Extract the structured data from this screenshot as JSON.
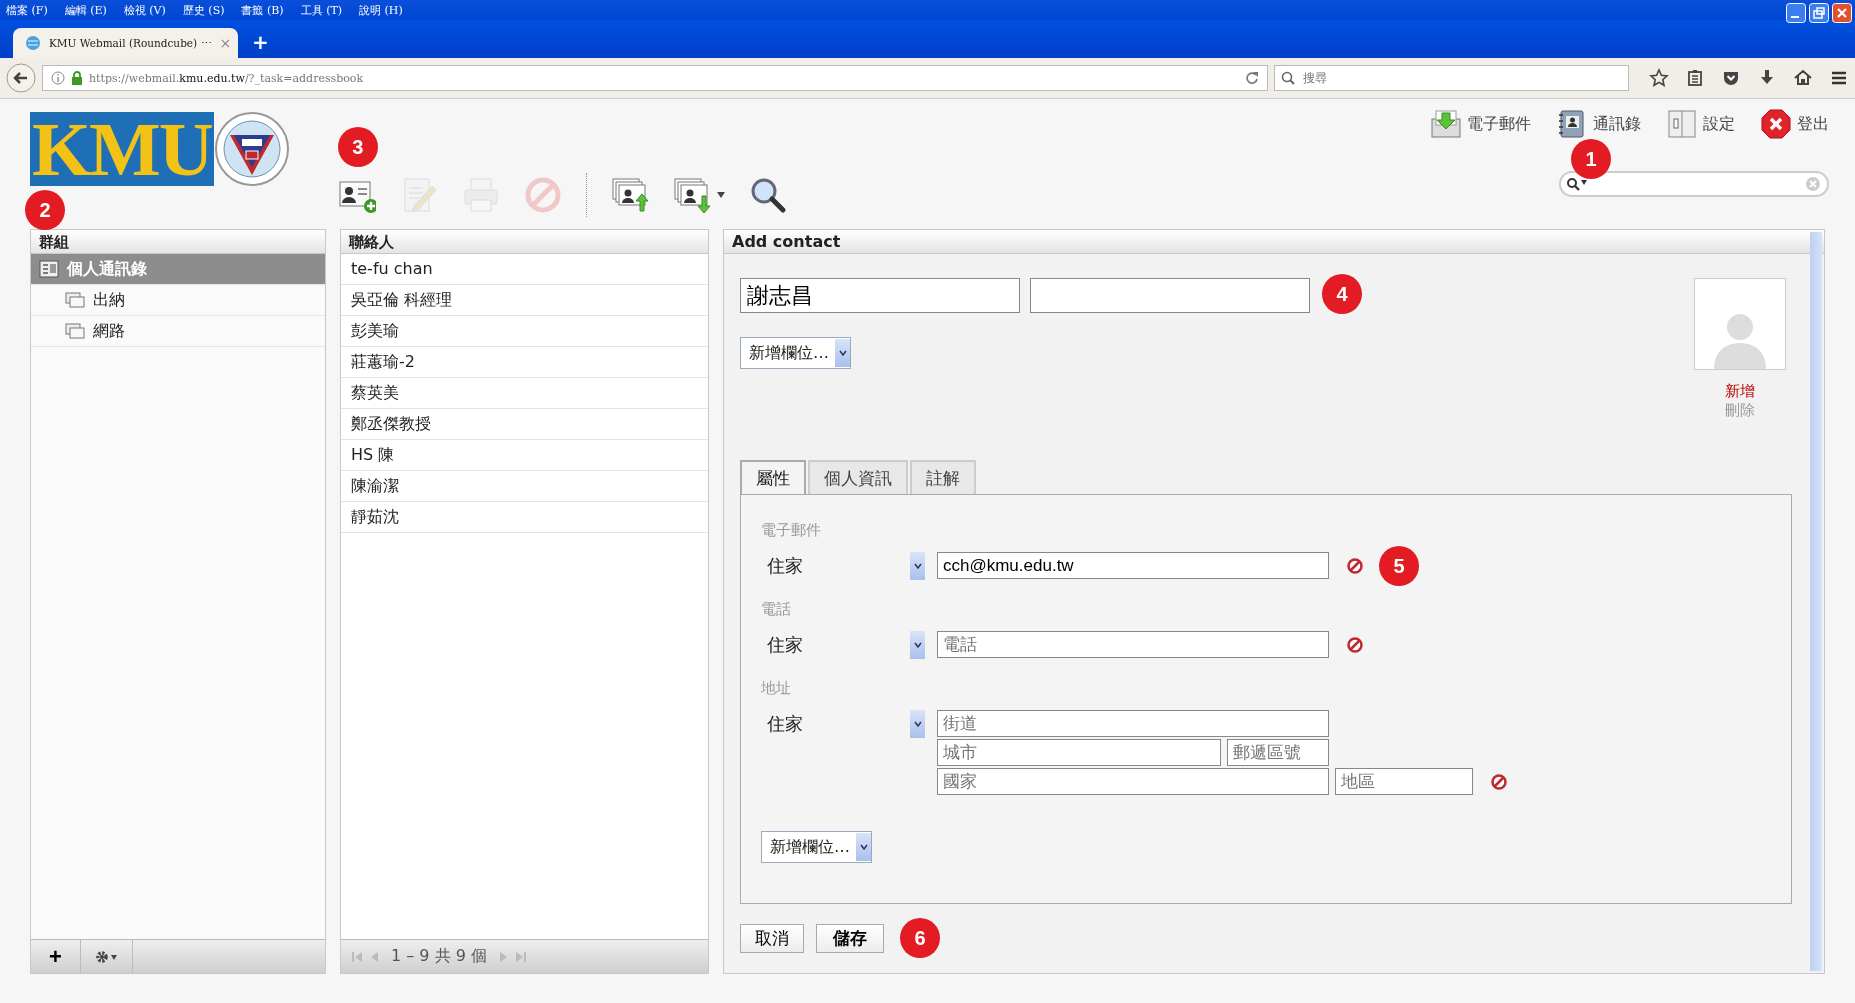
{
  "browser": {
    "menu": [
      "檔案 (F)",
      "編輯 (E)",
      "檢視 (V)",
      "歷史 (S)",
      "書籤 (B)",
      "工具 (T)",
      "說明 (H)"
    ],
    "tab": {
      "title": "KMU Webmail (Roundcube) ⋯",
      "close": "×"
    },
    "new_tab": "+",
    "url": {
      "host_prefix": "https://webmail.",
      "host": "kmu.edu.tw",
      "path": "/?_task=addressbook"
    },
    "search": {
      "placeholder": "搜尋"
    }
  },
  "app": {
    "logo": "KMU",
    "nav": [
      {
        "label": "電子郵件",
        "kind": "mail"
      },
      {
        "label": "通訊錄",
        "kind": "contacts"
      },
      {
        "label": "設定",
        "kind": "settings"
      },
      {
        "label": "登出",
        "kind": "logout"
      }
    ],
    "toolbar": [
      {
        "kind": "create",
        "disabled": false
      },
      {
        "kind": "edit",
        "disabled": true
      },
      {
        "kind": "print",
        "disabled": true
      },
      {
        "kind": "delete",
        "disabled": true
      },
      {
        "kind": "separator"
      },
      {
        "kind": "import",
        "disabled": false
      },
      {
        "kind": "export",
        "disabled": false
      },
      {
        "kind": "search",
        "disabled": false
      }
    ],
    "groups": {
      "title": "群組",
      "items": [
        {
          "label": "個人通訊錄",
          "selected": true,
          "children": [
            {
              "label": "出納",
              "selected": false
            },
            {
              "label": "網路",
              "selected": false
            }
          ]
        }
      ],
      "footer": [
        "+"
      ]
    },
    "contacts": {
      "title": "聯絡人",
      "items": [
        {
          "name": "te-fu chan",
          "selected": false
        },
        {
          "name": "吳亞倫 科經理",
          "selected": false
        },
        {
          "name": "彭美瑜",
          "selected": false
        },
        {
          "name": "莊蕙瑜-2",
          "selected": false
        },
        {
          "name": "蔡英美",
          "selected": false
        },
        {
          "name": "鄭丞傑教授",
          "selected": false
        },
        {
          "name": "HS 陳",
          "selected": false
        },
        {
          "name": "陳渝潔",
          "selected": false
        },
        {
          "name": "靜茹沈",
          "selected": false
        }
      ],
      "pager": "1 – 9 共 9 個"
    },
    "form": {
      "title": "Add contact",
      "name_value": "謝志昌",
      "add_field": "新增欄位…",
      "photo_actions": [
        {
          "label": "新增",
          "disabled": false
        },
        {
          "label": "刪除",
          "disabled": true
        }
      ],
      "tabs": [
        {
          "label": "屬性",
          "selected": true
        },
        {
          "label": "個人資訊",
          "selected": false
        },
        {
          "label": "註解",
          "selected": false
        }
      ],
      "sections": [
        {
          "title": "電子郵件",
          "type_label": "住家",
          "kind": "single",
          "fields": [
            {
              "value": "cch@kmu.edu.tw"
            }
          ]
        },
        {
          "title": "電話",
          "type_label": "住家",
          "kind": "single",
          "fields": [
            {
              "placeholder": "電話"
            }
          ]
        },
        {
          "title": "地址",
          "type_label": "住家",
          "kind": "address",
          "fields": [
            {
              "placeholder": "街道"
            },
            {
              "placeholder": "城市"
            },
            {
              "placeholder": "郵遞區號"
            },
            {
              "placeholder": "國家"
            },
            {
              "placeholder": "地區"
            }
          ]
        }
      ],
      "add_field_bottom": "新增欄位…",
      "buttons": [
        {
          "label": "取消",
          "primary": false
        },
        {
          "label": "儲存",
          "primary": true
        }
      ]
    },
    "annotations": [
      {
        "label": "1"
      },
      {
        "label": "2"
      },
      {
        "label": "3"
      },
      {
        "label": "4"
      },
      {
        "label": "5"
      },
      {
        "label": "6"
      }
    ]
  }
}
